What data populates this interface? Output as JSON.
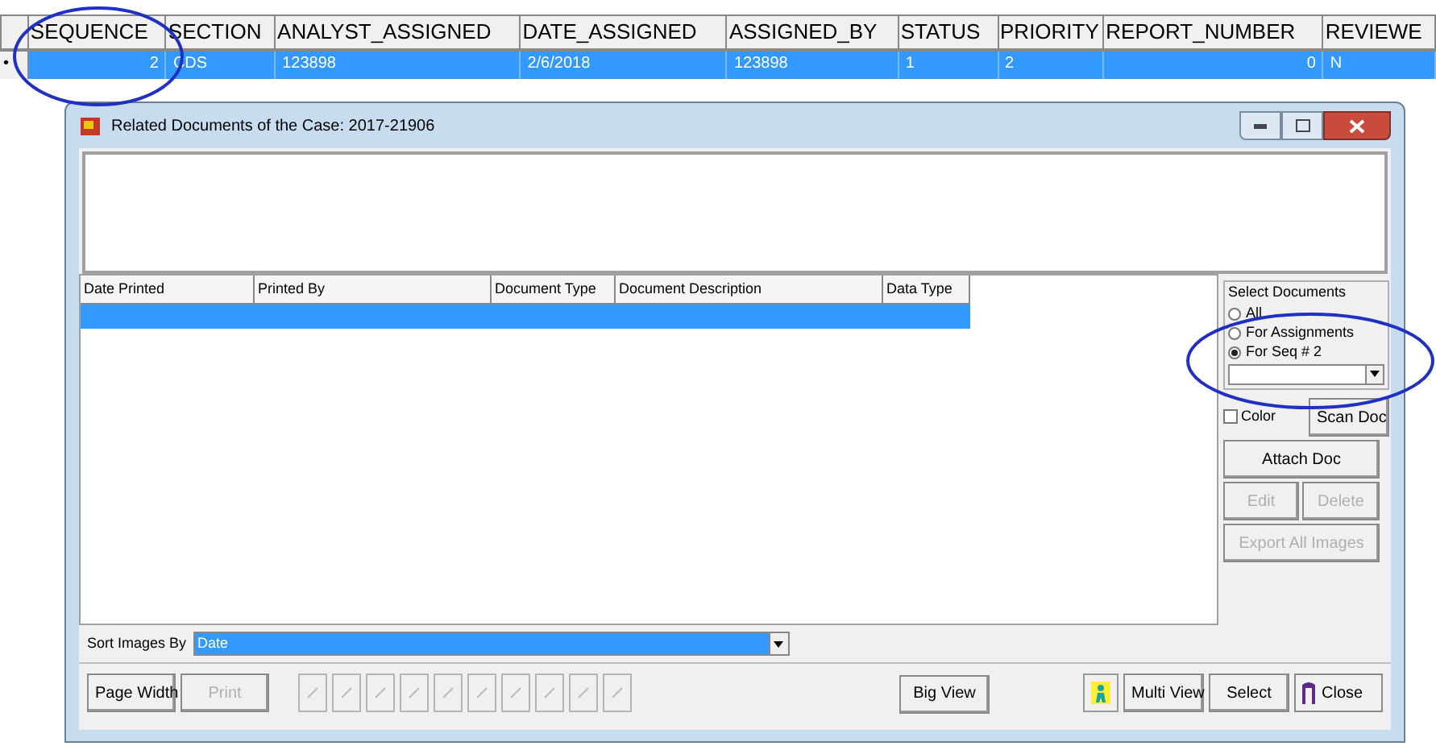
{
  "grid": {
    "columns": [
      "SEQUENCE",
      "SECTION",
      "ANALYST_ASSIGNED",
      "DATE_ASSIGNED",
      "ASSIGNED_BY",
      "STATUS",
      "PRIORITY",
      "REPORT_NUMBER",
      "REVIEWE"
    ],
    "rows": [
      {
        "selected": true,
        "marker": "•",
        "cells": [
          "2",
          "CDS",
          "123898",
          "2/6/2018",
          "123898",
          "1",
          "2",
          "0",
          "N"
        ]
      }
    ]
  },
  "window": {
    "title": "Related Documents of the Case: 2017-21906",
    "table": {
      "columns": [
        "Date Printed",
        "Printed By",
        "Document Type",
        "Document Description",
        "Data Type"
      ],
      "rows": [
        {
          "selected": true
        }
      ]
    },
    "select_documents": {
      "title": "Select Documents",
      "options": [
        {
          "label": "All",
          "selected": false
        },
        {
          "label": "For Assignments",
          "selected": false
        },
        {
          "label": "For Seq # 2",
          "selected": true
        }
      ]
    },
    "color_checkbox": {
      "label": "Color",
      "checked": false
    },
    "side_buttons": [
      {
        "label": "Scan Doc",
        "disabled": false
      },
      {
        "label": "Attach Doc",
        "disabled": false
      },
      {
        "label": "Edit",
        "disabled": true
      },
      {
        "label": "Delete",
        "disabled": true
      },
      {
        "label": "Export All Images",
        "disabled": true
      }
    ],
    "sort": {
      "label": "Sort Images By",
      "value": "Date"
    },
    "bottom_left": [
      {
        "label": "Page Width",
        "disabled": false
      },
      {
        "label": "Print",
        "disabled": true
      }
    ],
    "bottom_right": [
      {
        "label": "Big View"
      },
      {
        "label": "Multi View"
      },
      {
        "label": "Select"
      },
      {
        "label": "Close"
      }
    ]
  }
}
